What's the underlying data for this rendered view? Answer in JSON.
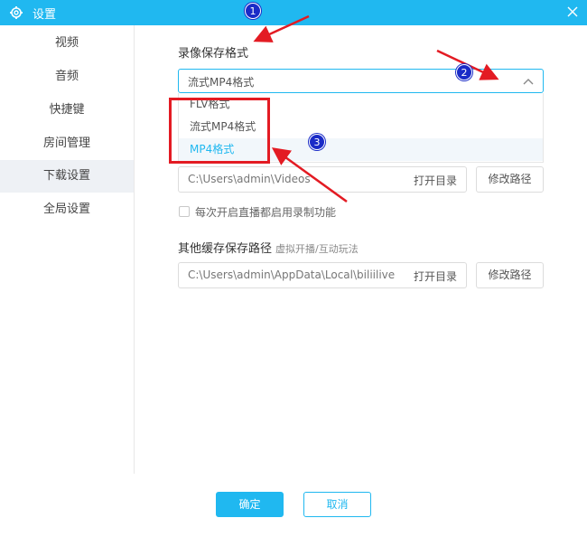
{
  "window": {
    "title": "设置"
  },
  "sidebar": {
    "items": [
      {
        "label": "视频"
      },
      {
        "label": "音频"
      },
      {
        "label": "快捷键"
      },
      {
        "label": "房间管理"
      },
      {
        "label": "下载设置"
      },
      {
        "label": "全局设置"
      }
    ],
    "active_index": 4
  },
  "recording": {
    "section_label": "录像保存格式",
    "selected": "流式MP4格式",
    "options": [
      "FLV格式",
      "流式MP4格式",
      "MP4格式"
    ],
    "highlighted_option": "MP4格式"
  },
  "download_path": {
    "value": "C:\\Users\\admin\\Videos",
    "open_dir_label": "打开目录",
    "change_path_label": "修改路径"
  },
  "auto_record": {
    "checked": false,
    "label": "每次开启直播都启用录制功能"
  },
  "cache_path": {
    "section_label": "其他缓存保存路径",
    "hint": "虚拟开播/互动玩法",
    "value": "C:\\Users\\admin\\AppData\\Local\\biliilive",
    "open_dir_label": "打开目录",
    "change_path_label": "修改路径"
  },
  "footer": {
    "ok_label": "确定",
    "cancel_label": "取消"
  },
  "annotations": {
    "badges": [
      "1",
      "2",
      "3"
    ],
    "color_arrow": "#e31b23",
    "color_badge": "#1a2bc7"
  },
  "colors": {
    "accent": "#20b8f0"
  }
}
